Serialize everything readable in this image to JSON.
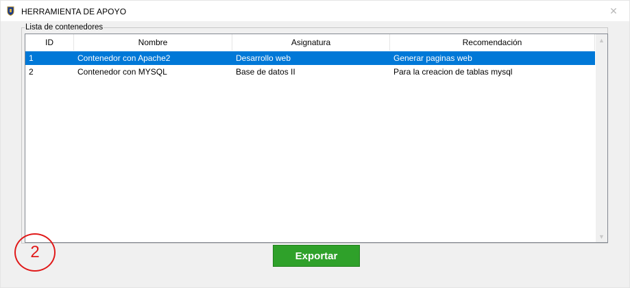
{
  "window": {
    "title": "HERRAMIENTA DE APOYO",
    "close_glyph": "✕"
  },
  "group": {
    "label": "Lista de contenedores"
  },
  "table": {
    "columns": [
      "ID",
      "Nombre",
      "Asignatura",
      "Recomendación"
    ],
    "rows": [
      [
        "1",
        "Contenedor con Apache2",
        "Desarrollo web",
        "Generar paginas web"
      ],
      [
        "2",
        "Contenedor con MYSQL",
        "Base de datos II",
        "Para la creacion de tablas mysql"
      ]
    ],
    "selected_row": 0
  },
  "scrollbar": {
    "up_glyph": "▲",
    "down_glyph": "▼"
  },
  "buttons": {
    "export_label": "Exportar"
  },
  "annotation": {
    "label": "2",
    "color": "#e01818"
  },
  "colors": {
    "selection": "#0078d7",
    "export_button": "#2fa12a"
  },
  "icons": {
    "app": "shield-icon",
    "close": "close-icon"
  }
}
